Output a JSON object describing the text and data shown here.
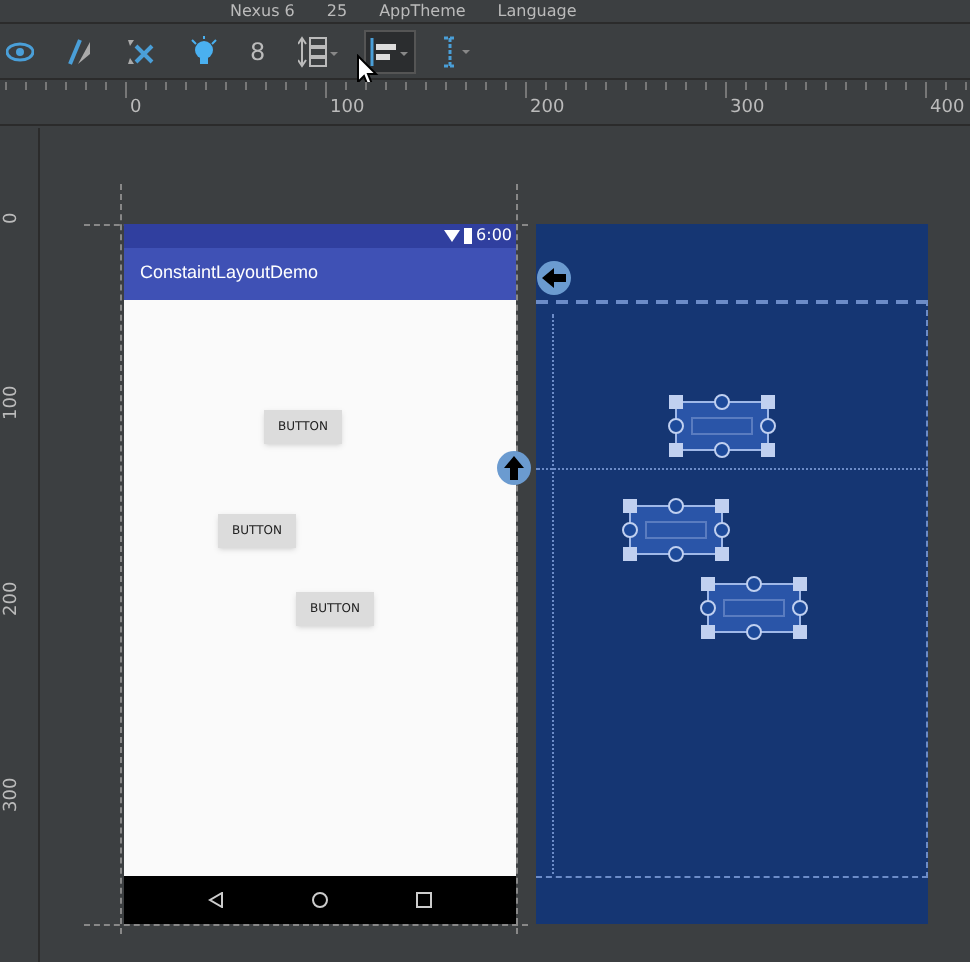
{
  "device_bar": {
    "device": "Nexus 6",
    "api": "25",
    "theme": "AppTheme",
    "language": "Language"
  },
  "toolbar": {
    "tools": [
      {
        "kind": "eye",
        "selected": false
      },
      {
        "kind": "magnet",
        "selected": false
      },
      {
        "kind": "clear",
        "selected": false
      },
      {
        "kind": "infer",
        "selected": false
      },
      {
        "kind": "margin",
        "label": "8",
        "selected": false
      },
      {
        "kind": "pack",
        "selected": false
      },
      {
        "kind": "align",
        "selected": true
      },
      {
        "kind": "guideline",
        "selected": false
      }
    ]
  },
  "ruler": {
    "x_labels": [
      "0",
      "100",
      "200",
      "300",
      "400"
    ],
    "y_labels": [
      "0",
      "100",
      "200",
      "300"
    ]
  },
  "design": {
    "status_time": "6:00",
    "app_title": "ConstaintLayoutDemo",
    "buttons": [
      {
        "label": "BUTTON"
      },
      {
        "label": "BUTTON"
      },
      {
        "label": "BUTTON"
      }
    ]
  }
}
